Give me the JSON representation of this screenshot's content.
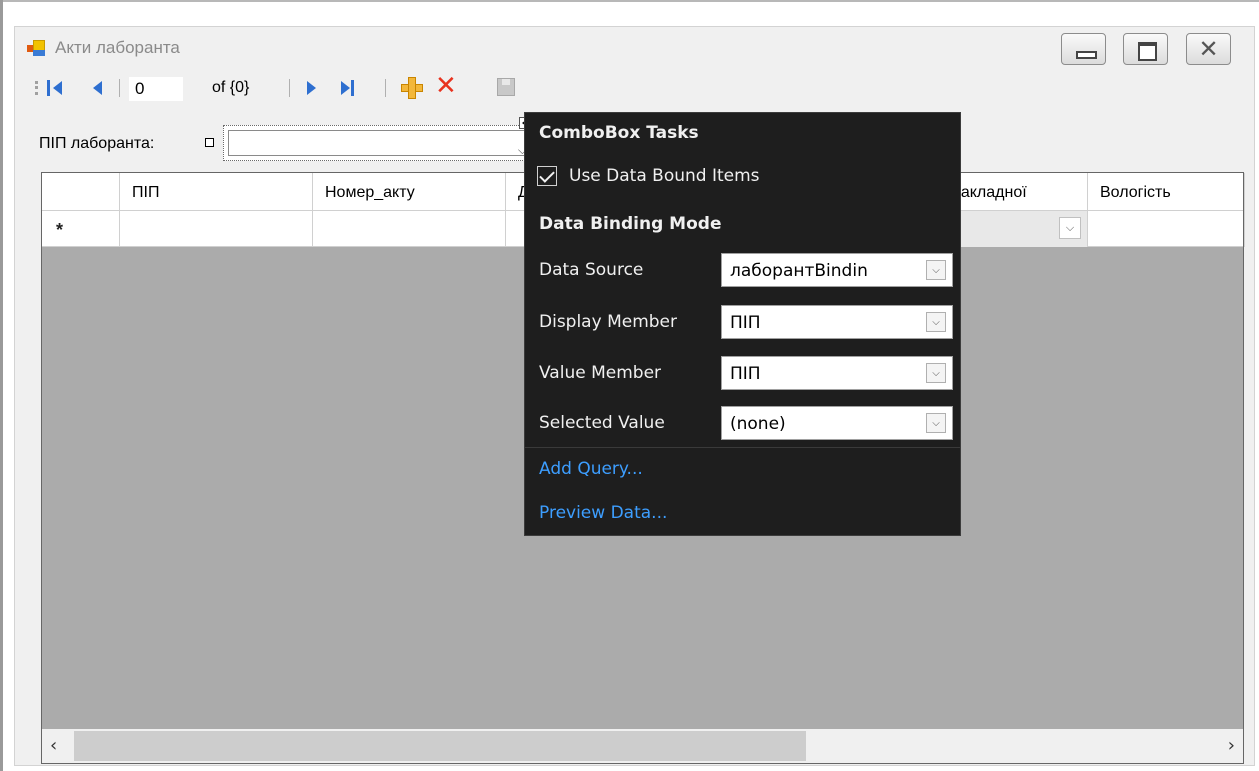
{
  "window": {
    "title": "Акти лаборанта"
  },
  "navigator": {
    "position": "0",
    "count_label": "of {0}"
  },
  "form": {
    "pib_label": "ПІП лаборанта:"
  },
  "grid": {
    "columns": [
      "ПІП",
      "Номер_акту",
      "Д",
      "",
      "накладної",
      "Вологість"
    ],
    "new_row_marker": "*"
  },
  "tasks_panel": {
    "title": "ComboBox Tasks",
    "use_data_bound_label": "Use Data Bound Items",
    "use_data_bound_checked": true,
    "section_title": "Data Binding Mode",
    "rows": [
      {
        "label": "Data Source",
        "value": "лаборантBindin"
      },
      {
        "label": "Display Member",
        "value": "ПІП"
      },
      {
        "label": "Value Member",
        "value": "ПІП"
      },
      {
        "label": "Selected Value",
        "value": "(none)"
      }
    ],
    "links": [
      "Add Query...",
      "Preview Data..."
    ]
  },
  "colors": {
    "link": "#3d9eff",
    "panel_bg": "#1e1e1e",
    "grid_bg": "#ababab",
    "nav_blue": "#2e6fd0",
    "delete_red": "#e8321e"
  },
  "icons": [
    "app-form-icon",
    "move-first-icon",
    "move-previous-icon",
    "move-next-icon",
    "move-last-icon",
    "add-new-icon",
    "delete-icon",
    "save-icon",
    "minimize-icon",
    "maximize-icon",
    "close-icon",
    "smart-tag-icon",
    "dropdown-arrow-icon",
    "checkmark-icon",
    "scroll-left-icon",
    "scroll-right-icon"
  ]
}
